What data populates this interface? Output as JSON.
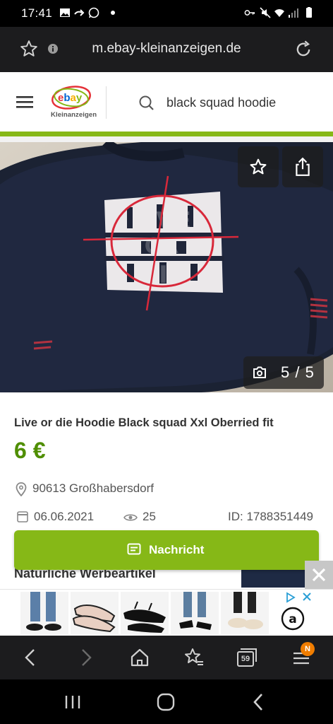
{
  "status_bar": {
    "time": "17:41",
    "icons": [
      "image-icon",
      "call-forward-icon",
      "whatsapp-icon",
      "dot-icon",
      "key-icon",
      "mute-icon",
      "wifi-icon",
      "signal-icon",
      "battery-icon"
    ]
  },
  "browser": {
    "url": "m.ebay-kleinanzeigen.de",
    "tab_count": "59",
    "menu_badge": "N"
  },
  "header": {
    "logo_word": "ebay",
    "logo_sub": "Kleinanzeigen",
    "search_query": "black squad hoodie"
  },
  "gallery": {
    "counter": "5 / 5",
    "print_text": [
      "LIVE",
      "OR",
      "DIE"
    ]
  },
  "listing": {
    "title": "Live or die Hoodie Black squad Xxl Oberried fit",
    "price": "6 €",
    "location": "90613 Großhabersdorf",
    "date": "06.06.2021",
    "views": "25",
    "id": "ID: 1788351449"
  },
  "actions": {
    "message_button": "Nachricht"
  },
  "ads": {
    "section_title": "Natürliche Werbeartikel"
  },
  "colors": {
    "brand_green": "#86b817",
    "price_green": "#4f8e00"
  }
}
